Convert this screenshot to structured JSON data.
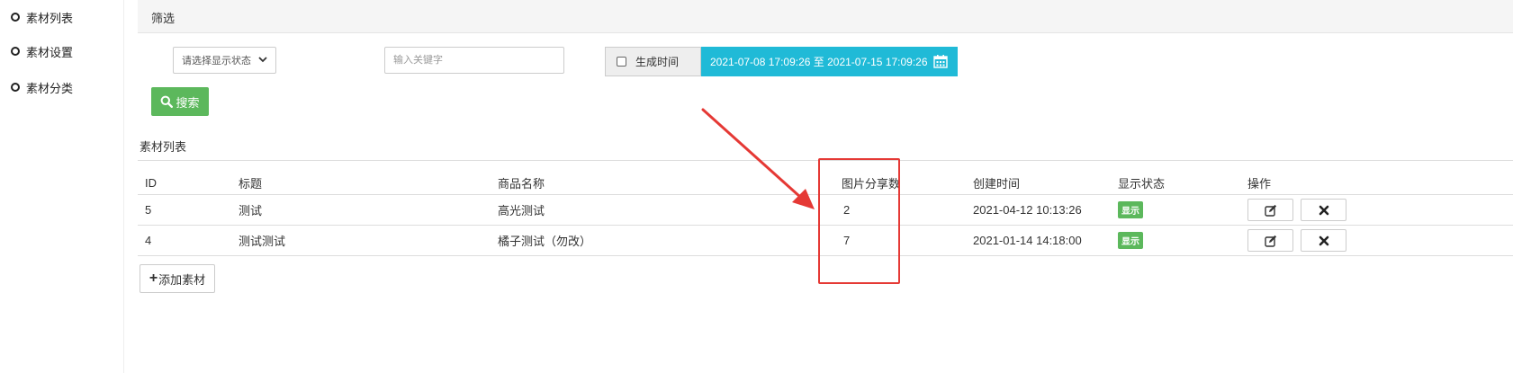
{
  "sidebar": {
    "items": [
      {
        "label": "素材列表"
      },
      {
        "label": "素材设置"
      },
      {
        "label": "素材分类"
      }
    ]
  },
  "filter": {
    "header": "筛选",
    "status_select": "请选择显示状态",
    "keyword_placeholder": "输入关键字",
    "gen_time_label": "生成时间",
    "date_range": "2021-07-08 17:09:26 至 2021-07-15 17:09:26",
    "search_label": "搜索"
  },
  "list": {
    "title": "素材列表",
    "columns": [
      "ID",
      "标题",
      "商品名称",
      "图片分享数",
      "创建时间",
      "显示状态",
      "操作"
    ],
    "rows": [
      {
        "id": "5",
        "title": "测试",
        "goods": "高光测试",
        "shares": "2",
        "created": "2021-04-12 10:13:26",
        "status": "显示"
      },
      {
        "id": "4",
        "title": "测试测试",
        "goods": "橘子测试（勿改）",
        "shares": "7",
        "created": "2021-01-14 14:18:00",
        "status": "显示"
      }
    ],
    "add_label": "添加素材"
  },
  "colors": {
    "accent_cyan": "#20bad7",
    "success_green": "#5cb85c",
    "annotation_red": "#e53935"
  }
}
